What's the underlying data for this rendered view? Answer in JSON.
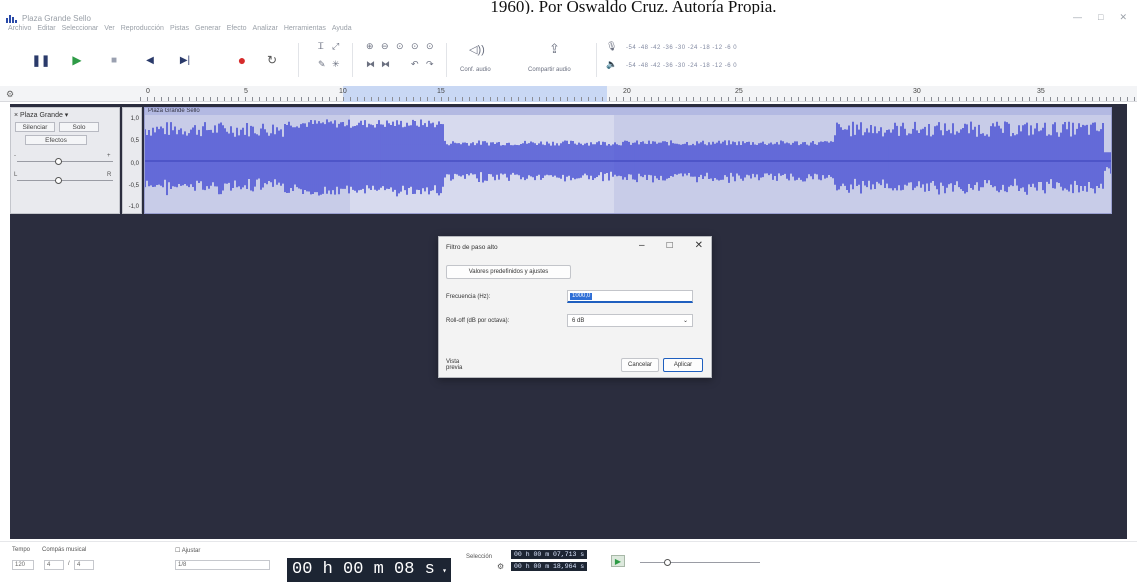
{
  "caption": "1960). Por Oswaldo Cruz. Autoría Propia.",
  "window": {
    "title": "Plaza Grande Sello",
    "controls": [
      "—",
      "□",
      "✕"
    ]
  },
  "menu": [
    "Archivo",
    "Editar",
    "Seleccionar",
    "Ver",
    "Reproducción",
    "Pistas",
    "Generar",
    "Efecto",
    "Analizar",
    "Herramientas",
    "Ayuda"
  ],
  "toolbar": {
    "transport": [
      "pause-icon",
      "play-icon",
      "stop-icon",
      "skip-start-icon",
      "skip-end-icon",
      "record-icon",
      "loop-icon"
    ],
    "colors": {
      "play": "#2e9b46",
      "record": "#d62b2b",
      "transport": "#2a3a6a"
    },
    "audio_setup_label": "Conf. audio",
    "share_audio_label": "Compartir audio",
    "meter_record": "-54 -48 -42 -36 -30 -24 -18 -12 -6 0",
    "meter_play": "-54 -48 -42 -36 -30 -24 -18 -12 -6 0"
  },
  "ruler": {
    "marks": [
      "0",
      "5",
      "10",
      "15",
      "20",
      "25",
      "30",
      "35"
    ]
  },
  "track": {
    "name": "Plaza Grande",
    "mute": "Silenciar",
    "solo": "Solo",
    "effects": "Efectos",
    "clip_name": "Plaza Grande Sello",
    "scale": [
      "1,0",
      "0,5",
      "0,0",
      "-0,5",
      "-1,0"
    ],
    "wave_color": "#4a52d4",
    "wave_bg": "#c8cce8"
  },
  "dialog": {
    "title": "Filtro de paso alto",
    "presets_button": "Valores predefinidos y ajustes",
    "frequency_label": "Frecuencia (Hz):",
    "frequency_value": "1000,0",
    "rolloff_label": "Roll-off (dB por octava):",
    "rolloff_value": "6 dB",
    "preview_button": "Vista previa",
    "cancel_button": "Cancelar",
    "apply_button": "Aplicar"
  },
  "bottom": {
    "tempo_label": "Tempo",
    "tempo_value": "120",
    "time_signature_label": "Compás musical",
    "time_signature_num": "4",
    "time_signature_den": "4",
    "snap_label": "Ajustar",
    "snap_value": "1/8",
    "time_display": "00 h 00 m 08 s",
    "selection_label": "Selección",
    "selection_start": "00 h 00 m 07,713 s",
    "selection_end": "00 h 00 m 18,964 s"
  }
}
